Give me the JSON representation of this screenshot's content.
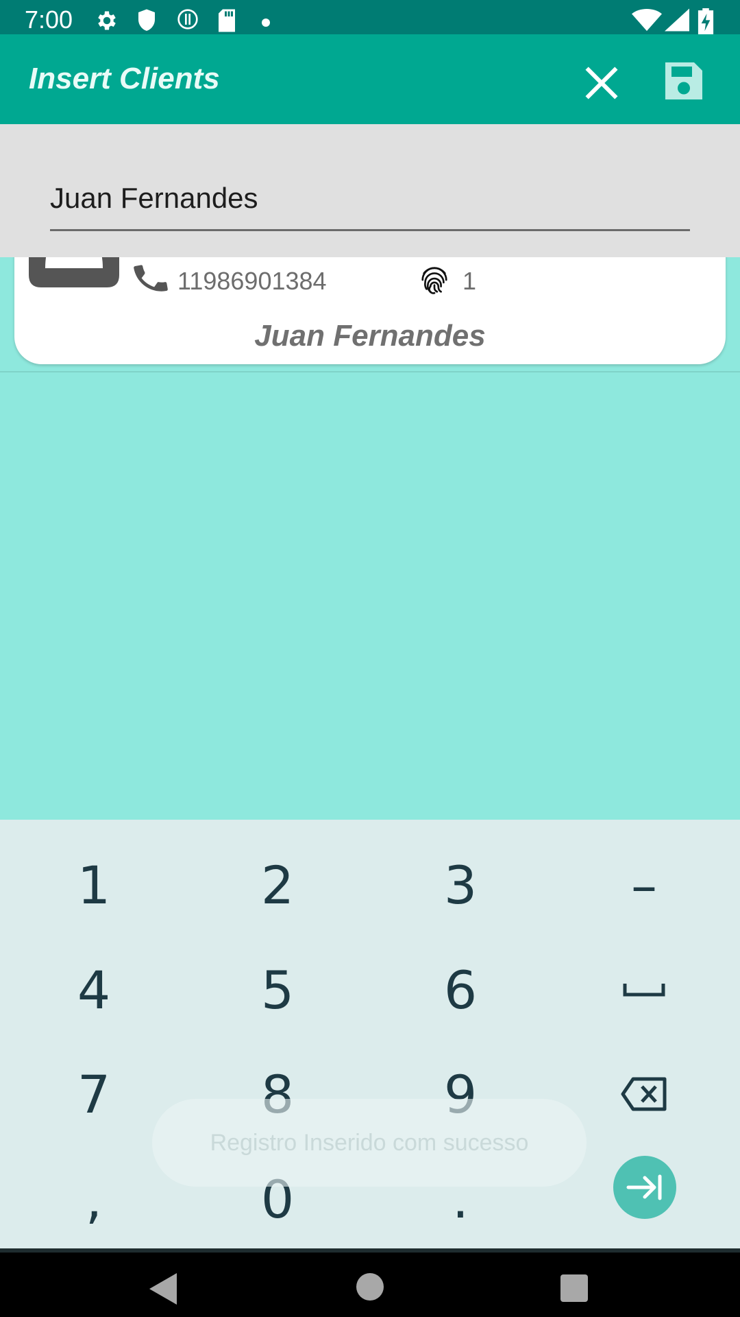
{
  "status_bar": {
    "time": "7:00"
  },
  "app_bar": {
    "title": "Insert Clients",
    "close_icon": "close-icon",
    "save_icon": "save-icon"
  },
  "form": {
    "name_value": "Juan Fernandes"
  },
  "clients": [
    {
      "phone": "11986901384",
      "count": "1",
      "name": "Juan Fernandes"
    }
  ],
  "keyboard": {
    "keys": [
      "1",
      "2",
      "3",
      "–",
      "4",
      "5",
      "6",
      "␣",
      "7",
      "8",
      "9",
      "⌫",
      ",",
      "0",
      "."
    ],
    "enter_icon": "tab-next-icon"
  },
  "toast": {
    "message": "Registro Inserido com sucesso"
  },
  "colors": {
    "status_bar": "#007c73",
    "app_bar": "#00a891",
    "list_background": "#8ee8dd",
    "keyboard_background": "#dcecec",
    "accent": "#4fc1b3"
  }
}
